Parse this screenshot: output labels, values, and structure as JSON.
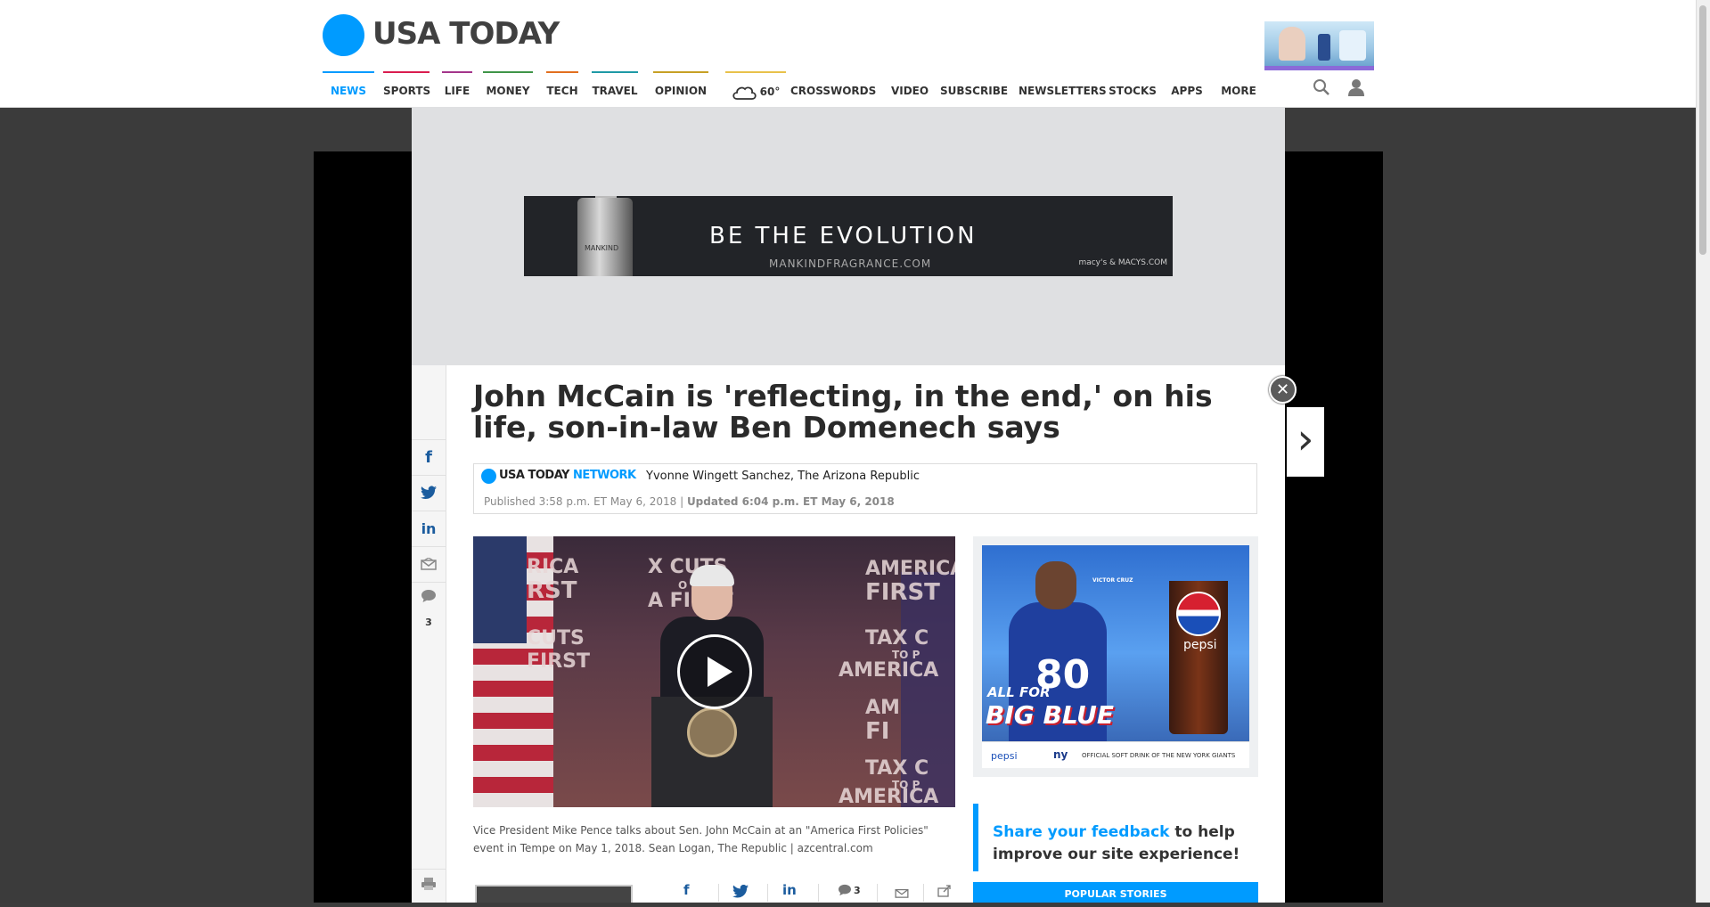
{
  "site": {
    "logo_text": "USA TODAY"
  },
  "nav": {
    "items": [
      {
        "label": "NEWS",
        "color": "#009bff"
      },
      {
        "label": "SPORTS",
        "color": "#da1d4f"
      },
      {
        "label": "LIFE",
        "color": "#a4358a"
      },
      {
        "label": "MONEY",
        "color": "#3f9548"
      },
      {
        "label": "TECH",
        "color": "#e26f1f"
      },
      {
        "label": "TRAVEL",
        "color": "#1e9aa6"
      },
      {
        "label": "OPINION",
        "color": "#c7a025"
      },
      {
        "label": "60°",
        "color": "#e8c14a",
        "icon": "cloud-icon"
      },
      {
        "label": "CROSSWORDS",
        "color": "transparent"
      },
      {
        "label": "VIDEO",
        "color": "transparent"
      },
      {
        "label": "SUBSCRIBE",
        "color": "transparent"
      },
      {
        "label": "NEWSLETTERS",
        "color": "transparent"
      },
      {
        "label": "STOCKS",
        "color": "transparent"
      },
      {
        "label": "APPS",
        "color": "transparent"
      },
      {
        "label": "MORE",
        "color": "transparent"
      }
    ]
  },
  "banner_ad": {
    "headline": "BE THE EVOLUTION",
    "url": "MANKINDFRAGRANCE.COM",
    "store": "macy's & MACYS.COM",
    "bottle_label": "MANKIND"
  },
  "article": {
    "headline": "John McCain is 'reflecting, in the end,' on his life, son-in-law Ben Domenech says",
    "network_usa": "USA TODAY",
    "network_word": "NETWORK",
    "author": "Yvonne Wingett Sanchez, The Arizona Republic",
    "published": "Published 3:58 p.m. ET May 6, 2018 |",
    "updated": "Updated 6:04 p.m. ET May 6, 2018",
    "caption": "Vice President Mike Pence talks about Sen. John McCain at an \"America First Policies\" event in Tempe on May 1, 2018. Sean Logan, The Republic | azcentral.com",
    "comment_count": "3",
    "video_bg_text": [
      "RICA",
      "RST",
      "X CUTS",
      "O PUT",
      "A FIRST",
      "AMERICA",
      "FIRST",
      "CUTS",
      "FIRST",
      "TAX C",
      "TO P",
      "AMERICA",
      "AM",
      "FI",
      "TAX C",
      "TO P",
      "AMERICA"
    ]
  },
  "right_ad": {
    "tagline_small": "ALL FOR",
    "tagline_big": "BIG BLUE",
    "jersey_number": "80",
    "brand": "pepsi",
    "player": "VICTOR CRUZ",
    "footer_logo": "pepsi",
    "footer_team": "ny",
    "footer_text": "OFFICIAL SOFT DRINK OF THE NEW YORK GIANTS"
  },
  "feedback": {
    "link": "Share your feedback",
    "text": " to help improve our site experience!"
  },
  "popular": {
    "label": "POPULAR STORIES"
  }
}
